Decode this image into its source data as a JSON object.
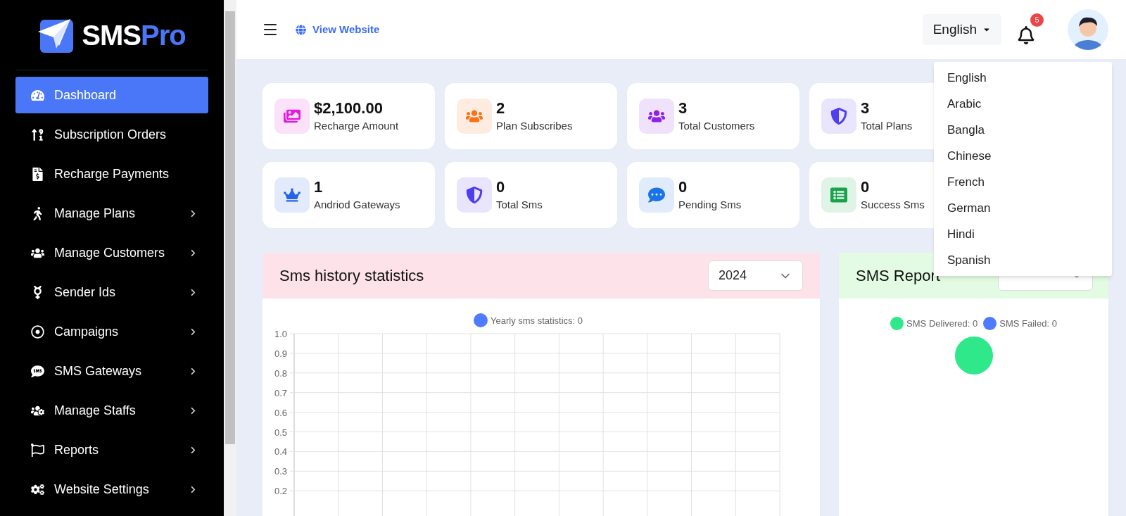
{
  "brand": {
    "name": "SMS",
    "name_accent": "Pro"
  },
  "sidebar": {
    "items": [
      {
        "label": "Dashboard",
        "selected": true,
        "submenu": false
      },
      {
        "label": "Subscription Orders",
        "selected": false,
        "submenu": false
      },
      {
        "label": "Recharge Payments",
        "selected": false,
        "submenu": false
      },
      {
        "label": "Manage Plans",
        "selected": false,
        "submenu": true
      },
      {
        "label": "Manage Customers",
        "selected": false,
        "submenu": true
      },
      {
        "label": "Sender Ids",
        "selected": false,
        "submenu": true
      },
      {
        "label": "Campaigns",
        "selected": false,
        "submenu": true
      },
      {
        "label": "SMS Gateways",
        "selected": false,
        "submenu": true
      },
      {
        "label": "Manage Staffs",
        "selected": false,
        "submenu": true
      },
      {
        "label": "Reports",
        "selected": false,
        "submenu": true
      },
      {
        "label": "Website Settings",
        "selected": false,
        "submenu": true
      }
    ]
  },
  "header": {
    "view_website": "View Website",
    "language": "English",
    "notifications": "5"
  },
  "language_menu": [
    "English",
    "Arabic",
    "Bangla",
    "Chinese",
    "French",
    "German",
    "Hindi",
    "Spanish"
  ],
  "stats": [
    {
      "value": "$2,100.00",
      "label": "Recharge Amount",
      "color": "#e41bd8"
    },
    {
      "value": "2",
      "label": "Plan Subscribes",
      "color": "#f97316"
    },
    {
      "value": "3",
      "label": "Total Customers",
      "color": "#8b22e6"
    },
    {
      "value": "3",
      "label": "Total Plans",
      "color": "#4f3df0"
    },
    {
      "value": "1",
      "label": "Andriod Gateways",
      "color": "#2563eb"
    },
    {
      "value": "0",
      "label": "Total Sms",
      "color": "#4f3df0"
    },
    {
      "value": "0",
      "label": "Pending Sms",
      "color": "#1a73e8"
    },
    {
      "value": "0",
      "label": "Success Sms",
      "color": "#16a34a"
    }
  ],
  "history_panel": {
    "title": "Sms history statistics",
    "year": "2024",
    "chart_data": {
      "type": "line",
      "grid": true,
      "ylim": [
        0.03,
        1.0
      ],
      "yticks": [
        {
          "value": 1.0,
          "label": "1.0"
        },
        {
          "value": 0.9,
          "label": "0.9"
        },
        {
          "value": 0.8,
          "label": "0.8"
        },
        {
          "value": 0.7,
          "label": "0.7"
        },
        {
          "value": 0.6,
          "label": "0.6"
        },
        {
          "value": 0.5,
          "label": "0.5"
        },
        {
          "value": 0.4,
          "label": "0.4"
        },
        {
          "value": 0.3,
          "label": "0.3"
        },
        {
          "value": 0.2,
          "label": "0.2"
        }
      ],
      "series": [
        {
          "name": "Yearly sms statistics: 0",
          "color": "#4f7cff"
        }
      ]
    }
  },
  "report_panel": {
    "title": "SMS Report",
    "legend": [
      {
        "label": "SMS Delivered: 0",
        "color": "#2ee88a"
      },
      {
        "label": "SMS Failed: 0",
        "color": "#4f7cff"
      }
    ]
  }
}
